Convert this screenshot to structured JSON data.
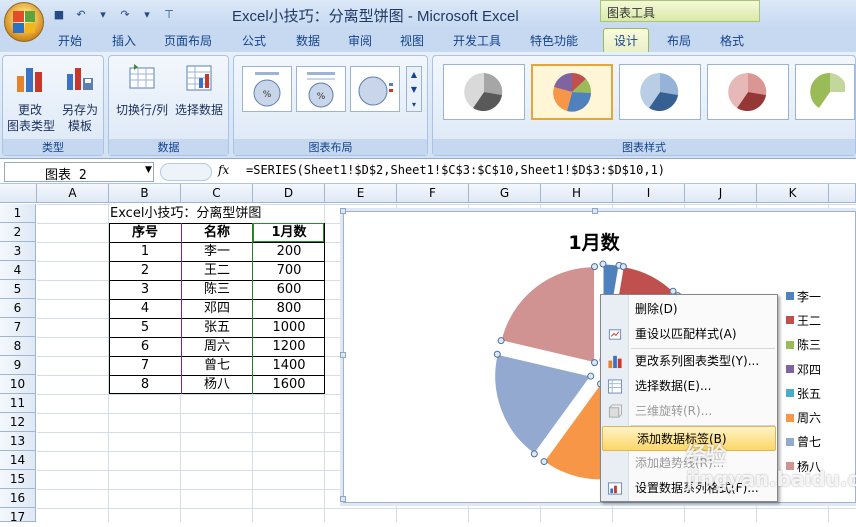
{
  "window": {
    "title": "Excel小技巧：分离型饼图 - Microsoft Excel",
    "context_tab_group": "图表工具"
  },
  "ribbon_tabs": [
    "开始",
    "插入",
    "页面布局",
    "公式",
    "数据",
    "审阅",
    "视图",
    "开发工具",
    "特色功能",
    "设计",
    "布局",
    "格式"
  ],
  "active_tab": "设计",
  "groups": {
    "type": {
      "label": "类型",
      "buttons": [
        "更改\n图表类型",
        "另存为\n模板"
      ]
    },
    "data": {
      "label": "数据",
      "buttons": [
        "切换行/列",
        "选择数据"
      ]
    },
    "layout": {
      "label": "图表布局"
    },
    "styles": {
      "label": "图表样式"
    }
  },
  "namebox": "图表 2",
  "formula": "=SERIES(Sheet1!$D$2,Sheet1!$C$3:$C$10,Sheet1!$D$3:$D$10,1)",
  "fx_label": "fx",
  "columns": [
    "A",
    "B",
    "C",
    "D",
    "E",
    "F",
    "G",
    "H",
    "I",
    "J",
    "K"
  ],
  "rows": [
    "1",
    "2",
    "3",
    "4",
    "5",
    "6",
    "7",
    "8",
    "9",
    "10",
    "11",
    "12",
    "13",
    "14",
    "15",
    "16",
    "17"
  ],
  "sheet": {
    "title": "Excel小技巧：分离型饼图",
    "headers": [
      "序号",
      "名称",
      "1月数"
    ],
    "data": [
      [
        "1",
        "李一",
        "200"
      ],
      [
        "2",
        "王二",
        "700"
      ],
      [
        "3",
        "陈三",
        "600"
      ],
      [
        "4",
        "邓四",
        "800"
      ],
      [
        "5",
        "张五",
        "1000"
      ],
      [
        "6",
        "周六",
        "1200"
      ],
      [
        "7",
        "曾七",
        "1400"
      ],
      [
        "8",
        "杨八",
        "1600"
      ]
    ]
  },
  "chart_data": {
    "type": "pie",
    "title": "1月数",
    "categories": [
      "李一",
      "王二",
      "陈三",
      "邓四",
      "张五",
      "周六",
      "曾七",
      "杨八"
    ],
    "values": [
      200,
      700,
      600,
      800,
      1000,
      1200,
      1400,
      1600
    ],
    "colors": [
      "#4f81bd",
      "#c0504d",
      "#9bbb59",
      "#8064a2",
      "#4bacc6",
      "#f79646",
      "#93a9cf",
      "#d19392"
    ],
    "exploded": true,
    "legend": "right"
  },
  "context_menu": {
    "items": [
      {
        "label": "删除(D)",
        "enabled": true
      },
      {
        "label": "重设以匹配样式(A)",
        "enabled": true
      },
      {
        "label": "更改系列图表类型(Y)...",
        "enabled": true
      },
      {
        "label": "选择数据(E)...",
        "enabled": true
      },
      {
        "label": "三维旋转(R)...",
        "enabled": false
      },
      {
        "label": "添加数据标签(B)",
        "enabled": true,
        "highlighted": true
      },
      {
        "label": "添加趋势线(R)...",
        "enabled": false
      },
      {
        "label": "设置数据系列格式(F)...",
        "enabled": true
      }
    ]
  },
  "watermark": "经验 jingyan.baidu.com"
}
